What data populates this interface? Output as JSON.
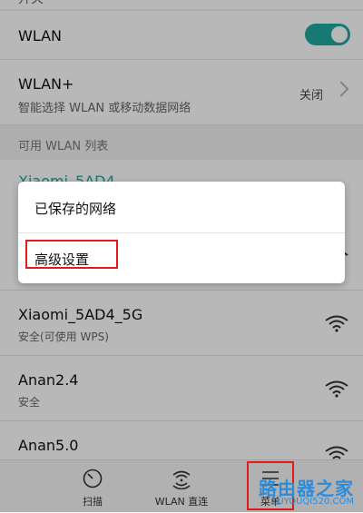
{
  "top_cut_label": "开关",
  "wlan_row": {
    "title": "WLAN",
    "enabled": true
  },
  "wlan_plus_row": {
    "title": "WLAN+",
    "subtitle": "智能选择 WLAN 或移动数据网络",
    "value": "关闭"
  },
  "available_header": "可用 WLAN 列表",
  "networks": [
    {
      "ssid": "Xiaomi_5AD4",
      "status": ""
    },
    {
      "ssid": "Xiaomi_5AD4_5G",
      "status": "安全(可使用 WPS)"
    },
    {
      "ssid": "Anan2.4",
      "status": "安全"
    },
    {
      "ssid": "Anan5.0",
      "status": "安全"
    }
  ],
  "popup_menu": {
    "items": [
      "已保存的网络",
      "高级设置"
    ]
  },
  "bottom_nav": {
    "items": [
      {
        "label": "扫描",
        "icon": "scan-icon"
      },
      {
        "label": "WLAN 直连",
        "icon": "wifi-direct-icon"
      },
      {
        "label": "菜单",
        "icon": "menu-icon"
      }
    ]
  },
  "watermark": {
    "title": "路由器之家",
    "url": "LUYOUQI520.COM"
  },
  "colors": {
    "accent": "#1fa8a0",
    "highlight": "#e31a1a",
    "watermark": "#2c8cdc"
  }
}
